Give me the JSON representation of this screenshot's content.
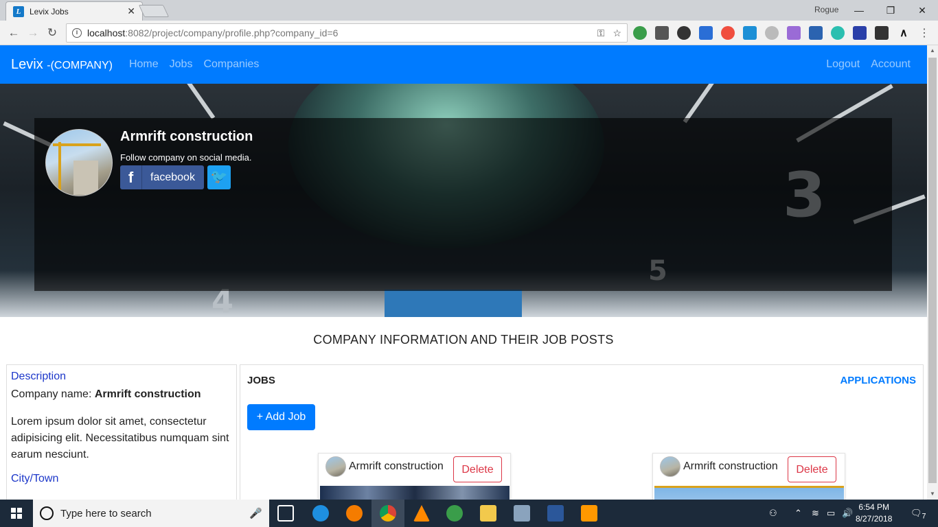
{
  "browser": {
    "tab_title": "Levix Jobs",
    "profile_name": "Rogue",
    "url_host": "localhost",
    "url_rest": ":8082/project/company/profile.php?company_id=6"
  },
  "navbar": {
    "brand": "Levix",
    "brand_sub": "-(COMPANY)",
    "links": [
      "Home",
      "Jobs",
      "Companies"
    ],
    "right_links": [
      "Logout",
      "Account"
    ]
  },
  "hero": {
    "company_name": "Armrift construction",
    "follow_text": "Follow company on social media.",
    "facebook_label": "facebook",
    "hero_digits": [
      "3",
      "4",
      "5"
    ]
  },
  "main": {
    "section_title": "COMPANY INFORMATION AND THEIR JOB POSTS",
    "left": {
      "description_label": "Description",
      "company_name_prefix": "Company name: ",
      "company_name": "Armrift construction",
      "lorem": "Lorem ipsum dolor sit amet, consectetur adipisicing elit. Necessitatibus numquam sint earum nesciunt.",
      "city_label": "City/Town"
    },
    "right": {
      "jobs_header": "JOBS",
      "applications_link": "APPLICATIONS",
      "add_job": "+ Add Job",
      "job_cards": [
        {
          "company": "Armrift construction",
          "delete": "Delete"
        },
        {
          "company": "Armrift construction",
          "delete": "Delete"
        }
      ]
    }
  },
  "taskbar": {
    "search_placeholder": "Type here to search",
    "time": "6:54 PM",
    "date": "8/27/2018",
    "notification_count": "7"
  },
  "colors": {
    "primary": "#007bff",
    "navbar": "#007bff",
    "danger": "#dc3545",
    "facebook": "#3b5998",
    "twitter": "#1da1f2",
    "label_blue": "#1b36c9"
  }
}
